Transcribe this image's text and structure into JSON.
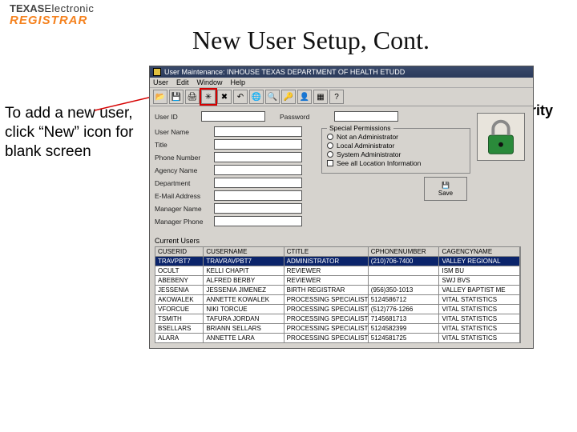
{
  "logo": {
    "line1a": "TEXAS",
    "line1b": "Electronic",
    "line2": "REGISTRAR"
  },
  "slide_title": "New User Setup, Cont.",
  "instruction": "To add a new user, click “New” icon for blank screen",
  "security_label": "Security",
  "window": {
    "title": "User Maintenance: INHOUSE  TEXAS DEPARTMENT OF HEALTH  ETUDD",
    "menus": [
      "User",
      "Edit",
      "Window",
      "Help"
    ],
    "toolbar_icons": [
      "folder-open-icon",
      "save-icon",
      "print-icon",
      "new-icon",
      "delete-icon",
      "undo-icon",
      "globe-icon",
      "search-icon",
      "key-icon",
      "user-icon",
      "grid-icon",
      "help-icon"
    ]
  },
  "form": {
    "userid_label": "User ID",
    "userid_value": "",
    "password_label": "Password",
    "password_value": "",
    "username_label": "User Name",
    "username_value": "",
    "title_label": "Title",
    "title_value": "",
    "phone_label": "Phone Number",
    "phone_value": "",
    "agency_label": "Agency Name",
    "agency_value": "",
    "dept_label": "Department",
    "dept_value": "",
    "email_label": "E-Mail Address",
    "email_value": "",
    "manager_label": "Manager Name",
    "manager_value": "",
    "mgrphone_label": "Manager Phone",
    "mgrphone_value": "",
    "permissions_group": "Special Permissions",
    "perm_options": [
      "Not an Administrator",
      "Local Administrator",
      "System Administrator"
    ],
    "perm_check": "See all Location Information",
    "save_btn": "Save"
  },
  "grid": {
    "heading": "Current Users",
    "columns": [
      "CUSERID",
      "CUSERNAME",
      "CTITLE",
      "CPHONENUMBER",
      "CAGENCYNAME"
    ],
    "rows": [
      {
        "sel": true,
        "c": [
          "TRAVPBT7",
          "TRAVRAVPBT7",
          "ADMINISTRATOR",
          "(210)706-7400",
          "VALLEY REGIONAL"
        ]
      },
      {
        "sel": false,
        "c": [
          "OCULT",
          "KELLI CHAPIT",
          "REVIEWER",
          "",
          "ISM BU"
        ]
      },
      {
        "sel": false,
        "c": [
          "ABEBENY",
          "ALFRED BERBY",
          "REVIEWER",
          "",
          "SWJ BVS"
        ]
      },
      {
        "sel": false,
        "c": [
          "JESSENIA",
          "JESSENIA JIMENEZ",
          "BIRTH REGISTRAR",
          "(956)350-1013",
          "VALLEY BAPTIST ME"
        ]
      },
      {
        "sel": false,
        "c": [
          "AKOWALEK",
          "ANNETTE KOWALEK",
          "PROCESSING SPECIALIST",
          "5124586712",
          "VITAL STATISTICS"
        ]
      },
      {
        "sel": false,
        "c": [
          "VFORCUE",
          "NIKI TORCUE",
          "PROCESSING SPECIALIST",
          "(512)776-1266",
          "VITAL STATISTICS"
        ]
      },
      {
        "sel": false,
        "c": [
          "TSMITH",
          "TAFURA JORDAN",
          "PROCESSING SPECIALIST",
          "7145681713",
          "VITAL STATISTICS"
        ]
      },
      {
        "sel": false,
        "c": [
          "BSELLARS",
          "BRIANN SELLARS",
          "PROCESSING SPECIALIST",
          "5124582399",
          "VITAL STATISTICS"
        ]
      },
      {
        "sel": false,
        "c": [
          "ALARA",
          "ANNETTE LARA",
          "PROCESSING SPECIALIST",
          "5124581725",
          "VITAL STATISTICS"
        ]
      }
    ]
  }
}
